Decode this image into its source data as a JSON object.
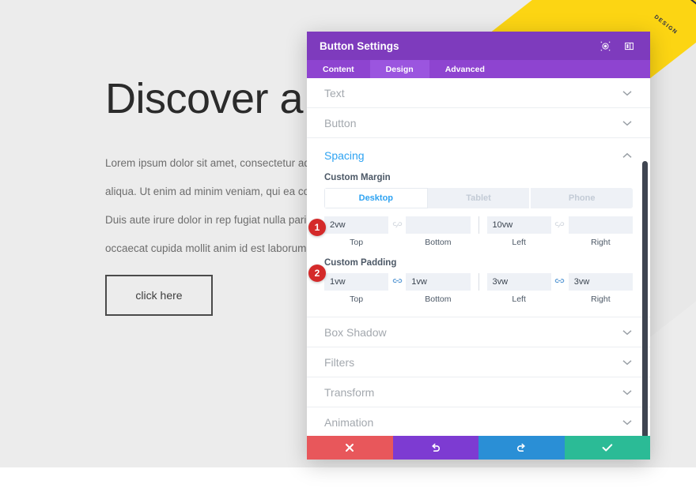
{
  "website": {
    "hero_title": "Discover a wh",
    "hero_body": "Lorem ipsum dolor sit amet, consectetur adipiscing dolore magna aliqua. Ut enim ad minim veniam, qui ea commodo consequat. Duis aute irure dolor in rep fugiat nulla pariatur. Excepteur sint occaecat cupida mollit anim id est laborum.",
    "cta_label": "click here",
    "decoration_label": "DESIGN",
    "colors": {
      "band_yellow": "#fcd513",
      "page_bg": "#ececec"
    }
  },
  "modal": {
    "title": "Button Settings",
    "header_icons": [
      "target-icon",
      "layout-icon"
    ],
    "tabs": [
      {
        "label": "Content",
        "active": false
      },
      {
        "label": "Design",
        "active": true
      },
      {
        "label": "Advanced",
        "active": false
      }
    ],
    "sections": [
      {
        "label": "Text",
        "open": false
      },
      {
        "label": "Button",
        "open": false
      },
      {
        "label": "Spacing",
        "open": true
      },
      {
        "label": "Box Shadow",
        "open": false
      },
      {
        "label": "Filters",
        "open": false
      },
      {
        "label": "Transform",
        "open": false
      },
      {
        "label": "Animation",
        "open": false
      }
    ],
    "spacing": {
      "responsive_tabs": [
        {
          "label": "Desktop",
          "active": true
        },
        {
          "label": "Tablet",
          "active": false
        },
        {
          "label": "Phone",
          "active": false
        }
      ],
      "margin": {
        "group_label": "Custom Margin",
        "step": "1",
        "linked_vertical": false,
        "linked_horizontal": false,
        "top": {
          "value": "2vw",
          "caption": "Top"
        },
        "bottom": {
          "value": "",
          "caption": "Bottom"
        },
        "left": {
          "value": "10vw",
          "caption": "Left"
        },
        "right": {
          "value": "",
          "caption": "Right"
        }
      },
      "padding": {
        "group_label": "Custom Padding",
        "step": "2",
        "linked_vertical": true,
        "linked_horizontal": true,
        "top": {
          "value": "1vw",
          "caption": "Top"
        },
        "bottom": {
          "value": "1vw",
          "caption": "Bottom"
        },
        "left": {
          "value": "3vw",
          "caption": "Left"
        },
        "right": {
          "value": "3vw",
          "caption": "Right"
        }
      }
    },
    "footer": [
      {
        "name": "cancel",
        "icon": "close-icon",
        "color": "#e8575b"
      },
      {
        "name": "undo",
        "icon": "undo-icon",
        "color": "#7d3bd2"
      },
      {
        "name": "redo",
        "icon": "redo-icon",
        "color": "#2a8fd6"
      },
      {
        "name": "save",
        "icon": "checkmark-icon",
        "color": "#2bbb96"
      }
    ],
    "accent_color": "#2ea3f2",
    "header_color": "#7e3bbd"
  }
}
